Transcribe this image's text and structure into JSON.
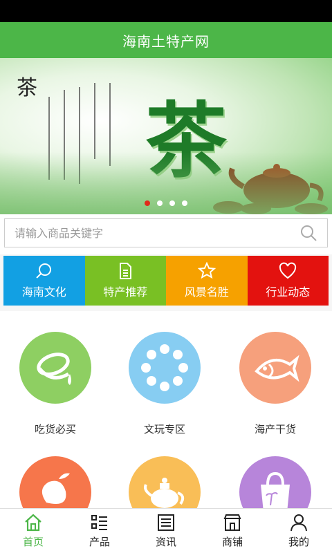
{
  "app": {
    "title": "海南土特产网"
  },
  "banner": {
    "calligraphy_title": "茶",
    "headline": "茶",
    "slides": 4,
    "active_slide": 0
  },
  "search": {
    "placeholder": "请输入商品关键字"
  },
  "categories": [
    {
      "label": "海南文化",
      "icon": "search-icon",
      "color": "#12a0e3"
    },
    {
      "label": "特产推荐",
      "icon": "document-icon",
      "color": "#79c024"
    },
    {
      "label": "风景名胜",
      "icon": "star-icon",
      "color": "#f6a100"
    },
    {
      "label": "行业动态",
      "icon": "heart-icon",
      "color": "#e3120f"
    }
  ],
  "grid": [
    {
      "label": "吃货必买",
      "icon": "food-icon",
      "color": "#8ecf62"
    },
    {
      "label": "文玩专区",
      "icon": "bracelet-icon",
      "color": "#87cdf2"
    },
    {
      "label": "海产干货",
      "icon": "fish-icon",
      "color": "#f6a07c"
    },
    {
      "label": "",
      "icon": "mango-icon",
      "color": "#f6764b"
    },
    {
      "label": "",
      "icon": "teapot-icon",
      "color": "#f9be57"
    },
    {
      "label": "",
      "icon": "bag-icon",
      "color": "#b785da"
    }
  ],
  "tabs": [
    {
      "label": "首页",
      "icon": "home-icon",
      "active": true
    },
    {
      "label": "产品",
      "icon": "list-icon",
      "active": false
    },
    {
      "label": "资讯",
      "icon": "news-icon",
      "active": false
    },
    {
      "label": "商铺",
      "icon": "shop-icon",
      "active": false
    },
    {
      "label": "我的",
      "icon": "user-icon",
      "active": false
    }
  ],
  "colors": {
    "brand": "#4cb648",
    "dot_active": "#e02a1a"
  }
}
